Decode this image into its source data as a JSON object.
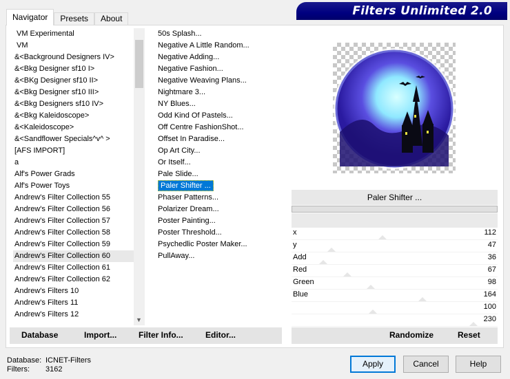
{
  "header": {
    "title": "Filters Unlimited 2.0"
  },
  "tabs": [
    {
      "label": "Navigator",
      "active": true
    },
    {
      "label": "Presets",
      "active": false
    },
    {
      "label": "About",
      "active": false
    }
  ],
  "categories": [
    "VM Experimental",
    "VM",
    "&<Background Designers IV>",
    "&<Bkg Designer sf10 I>",
    "&<BKg Designer sf10 II>",
    "&<Bkg Designer sf10 III>",
    "&<Bkg Designers sf10 IV>",
    "&<Bkg Kaleidoscope>",
    "&<Kaleidoscope>",
    "&<Sandflower Specials^v^ >",
    "[AFS IMPORT]",
    "a",
    "Alf's Power Grads",
    "Alf's Power Toys",
    "Andrew's Filter Collection 55",
    "Andrew's Filter Collection 56",
    "Andrew's Filter Collection 57",
    "Andrew's Filter Collection 58",
    "Andrew's Filter Collection 59",
    "Andrew's Filter Collection 60",
    "Andrew's Filter Collection 61",
    "Andrew's Filter Collection 62",
    "Andrew's Filters 10",
    "Andrew's Filters 11",
    "Andrew's Filters 12"
  ],
  "selected_category_index": 19,
  "filters": [
    "50s Splash...",
    "Negative A Little Random...",
    "Negative Adding...",
    "Negative Fashion...",
    "Negative Weaving Plans...",
    "Nightmare 3...",
    "NY Blues...",
    "Odd Kind Of Pastels...",
    "Off Centre FashionShot...",
    "Offset In Paradise...",
    "Op Art City...",
    "Or Itself...",
    "Pale Slide...",
    "Paler Shifter ...",
    "Phaser Patterns...",
    "Polarizer Dream...",
    "Poster Painting...",
    "Poster Threshold...",
    "Psychedlic Poster Maker...",
    "PullAway..."
  ],
  "selected_filter_index": 13,
  "preview": {
    "filter_name": "Paler Shifter ..."
  },
  "sliders": [
    {
      "label": "x",
      "value": "112",
      "fraction": 0.44
    },
    {
      "label": "y",
      "value": "47",
      "fraction": 0.18
    },
    {
      "label": "Add",
      "value": "36",
      "fraction": 0.14
    },
    {
      "label": "Red",
      "value": "67",
      "fraction": 0.26
    },
    {
      "label": "Green",
      "value": "98",
      "fraction": 0.38
    },
    {
      "label": "Blue",
      "value": "164",
      "fraction": 0.64
    },
    {
      "label": "",
      "value": "100",
      "fraction": 0.39
    },
    {
      "label": "",
      "value": "230",
      "fraction": 0.9
    }
  ],
  "toolbar": {
    "database": "Database",
    "import": "Import...",
    "filter_info": "Filter Info...",
    "editor": "Editor...",
    "randomize": "Randomize",
    "reset": "Reset"
  },
  "status": {
    "database_label": "Database:",
    "database_value": "ICNET-Filters",
    "filters_label": "Filters:",
    "filters_value": "3162"
  },
  "buttons": {
    "apply": "Apply",
    "cancel": "Cancel",
    "help": "Help"
  },
  "colors": {
    "title_bg": "#000080",
    "selection": "#0078d7"
  }
}
